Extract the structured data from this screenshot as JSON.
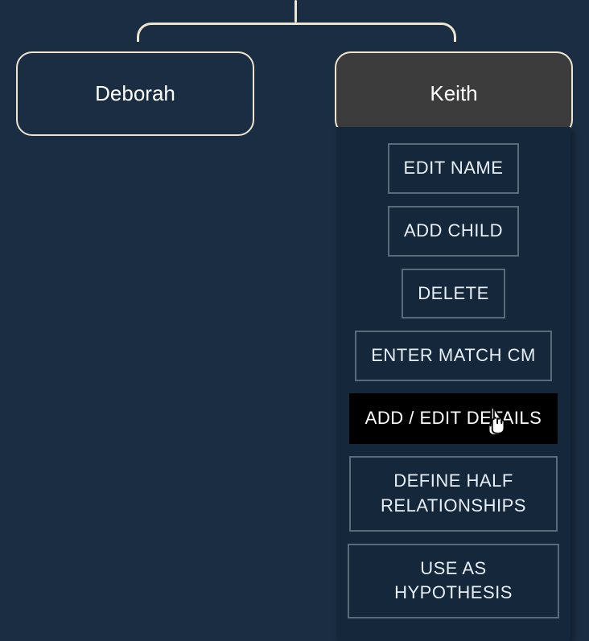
{
  "tree": {
    "nodes": {
      "left": {
        "name": "Deborah"
      },
      "right": {
        "name": "Keith",
        "selected": true
      }
    }
  },
  "menu": {
    "edit_name": "EDIT NAME",
    "add_child": "ADD CHILD",
    "delete": "DELETE",
    "enter_match_cm": "ENTER MATCH CM",
    "add_edit_details": "ADD / EDIT DETAILS",
    "define_half": "DEFINE HALF RELATIONSHIPS",
    "use_hypothesis": "USE AS HYPOTHESIS"
  },
  "colors": {
    "background": "#1a2d42",
    "node_border": "#eee5cf",
    "selected_node_bg": "#3c3c3c",
    "menu_bg": "#15273a",
    "button_border": "#5a6b7a"
  }
}
